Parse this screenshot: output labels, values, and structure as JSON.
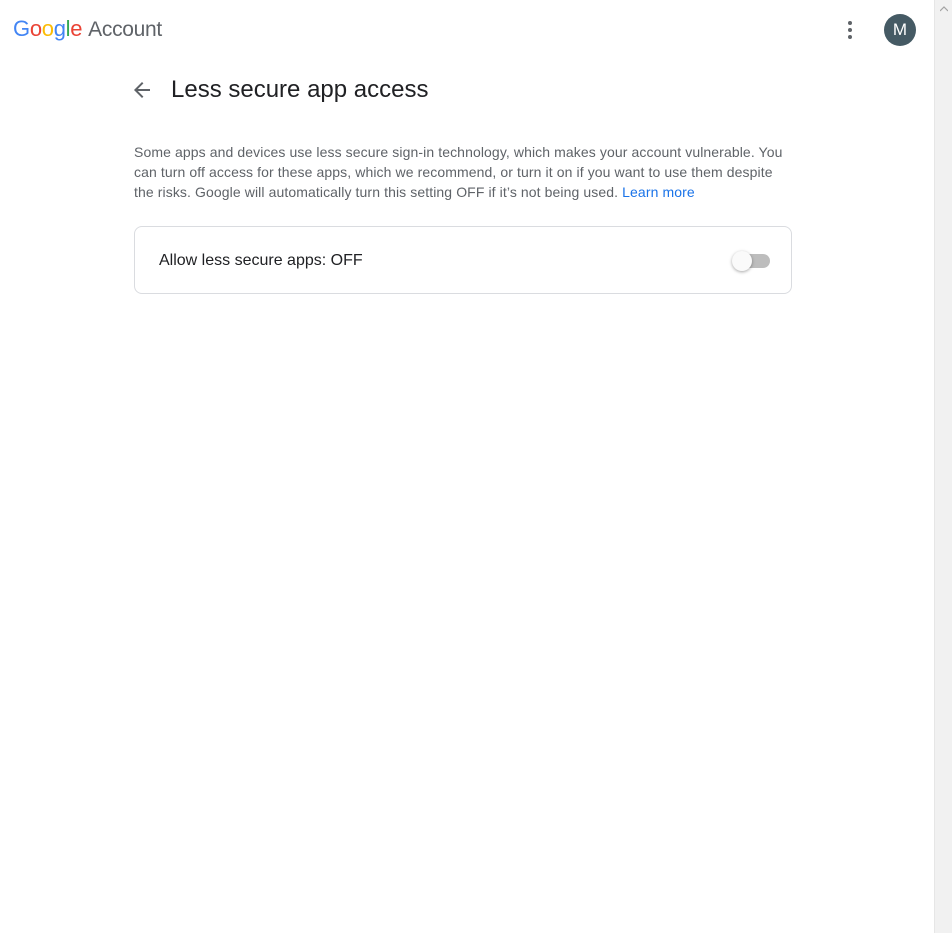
{
  "header": {
    "logo_letters": [
      {
        "char": "G",
        "color": "#4285f4"
      },
      {
        "char": "o",
        "color": "#ea4335"
      },
      {
        "char": "o",
        "color": "#fbbc05"
      },
      {
        "char": "g",
        "color": "#4285f4"
      },
      {
        "char": "l",
        "color": "#34a853"
      },
      {
        "char": "e",
        "color": "#ea4335"
      }
    ],
    "logo_suffix": "Account",
    "more_icon": "more-vert-icon",
    "avatar_initial": "M",
    "avatar_color": "#455a64"
  },
  "page": {
    "back_icon": "arrow-back-icon",
    "title": "Less secure app access",
    "description": "Some apps and devices use less secure sign-in technology, which makes your account vulnerable. You can turn off access for these apps, which we recommend, or turn it on if you want to use them despite the risks. Google will automatically turn this setting OFF if it’s not being used.",
    "learn_more": "Learn more",
    "link_color": "#1a73e8"
  },
  "setting": {
    "label": "Allow less secure apps: OFF",
    "toggle_on": false
  },
  "scrollbar": {
    "up_icon": "scroll-up-arrow-icon"
  }
}
